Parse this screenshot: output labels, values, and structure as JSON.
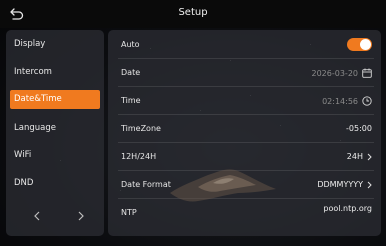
{
  "header": {
    "title": "Setup",
    "back_icon": "back-arrow-icon"
  },
  "sidebar": {
    "items": [
      {
        "label": "Display",
        "active": false
      },
      {
        "label": "Intercom",
        "active": false
      },
      {
        "label": "Date&Time",
        "active": true
      },
      {
        "label": "Language",
        "active": false
      },
      {
        "label": "WiFi",
        "active": false
      },
      {
        "label": "DND",
        "active": false
      }
    ],
    "prev_icon": "chevron-left-icon",
    "next_icon": "chevron-right-icon"
  },
  "settings": {
    "auto": {
      "label": "Auto",
      "enabled": true
    },
    "date": {
      "label": "Date",
      "value": "2026-03-20",
      "icon": "calendar-icon"
    },
    "time": {
      "label": "Time",
      "value": "02:14:56",
      "icon": "clock-icon"
    },
    "timezone": {
      "label": "TimeZone",
      "value": "-05:00"
    },
    "hour_format": {
      "label": "12H/24H",
      "value": "24H",
      "icon": "chevron-right-icon"
    },
    "date_format": {
      "label": "Date Format",
      "value": "DDMMYYYY",
      "icon": "chevron-right-icon"
    },
    "ntp": {
      "label": "NTP",
      "value": "pool.ntp.org"
    }
  },
  "colors": {
    "accent": "#f07a1f",
    "panel": "#2a2c32",
    "text": "#e6e6e6"
  }
}
